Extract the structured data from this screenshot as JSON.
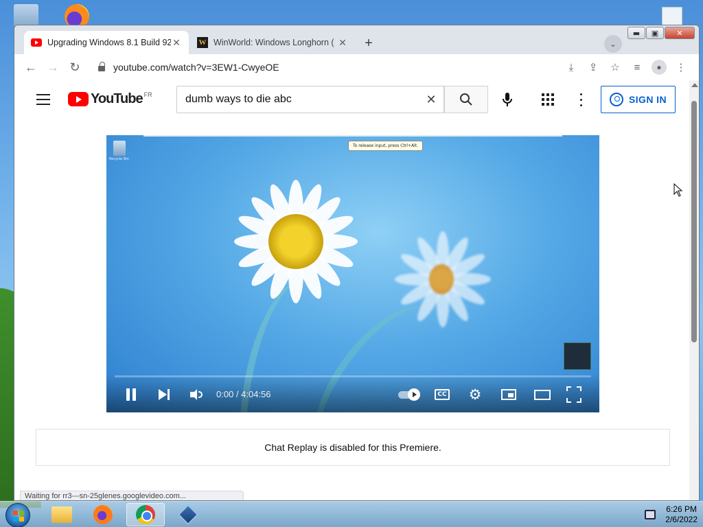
{
  "browser": {
    "tabs": [
      {
        "label": "Upgrading Windows 8.1 Build 92",
        "favicon": "youtube-icon",
        "active": true
      },
      {
        "label": "WinWorld: Windows Longhorn (",
        "favicon": "winworld-icon",
        "active": false
      }
    ],
    "new_tab": "+",
    "tab_search": "⌄",
    "window_controls": {
      "minimize": "▬",
      "maximize": "▣",
      "close": "✕"
    },
    "url": "youtube.com/watch?v=3EW1-CwyeOE",
    "nav": {
      "back": "←",
      "forward": "→",
      "reload": "↻"
    },
    "toolbar_icons": {
      "install": "⤓",
      "share": "⇪",
      "bookmark": "☆",
      "media": "≡",
      "profile": "●",
      "menu": "⋮"
    },
    "status_text": "Waiting for rr3---sn-25glenes.googlevideo.com..."
  },
  "youtube": {
    "logo_text": "YouTube",
    "country_code": "FR",
    "search": {
      "value": "dumb ways to die abc",
      "clear": "✕"
    },
    "sign_in_label": "SIGN IN"
  },
  "video": {
    "vm_tooltip": "To release input, press Ctrl+Alt.",
    "vm_recycle_label": "Recycle Bin",
    "time_current": "0:00",
    "time_total": "4:04:56",
    "time_display": "0:00 / 4:04:56",
    "progress_fraction": 0,
    "cc_label": "CC",
    "settings_glyph": "⚙",
    "autoplay_on": true
  },
  "chat": {
    "message": "Chat Replay is disabled for this Premiere."
  },
  "taskbar": {
    "clock_time": "6:26 PM",
    "clock_date": "2/6/2022",
    "pinned": [
      "file-explorer",
      "firefox",
      "chrome",
      "virtualbox"
    ]
  },
  "colors": {
    "youtube_red": "#ff0000",
    "signin_blue": "#065fd4",
    "progress": "#ff0000"
  }
}
